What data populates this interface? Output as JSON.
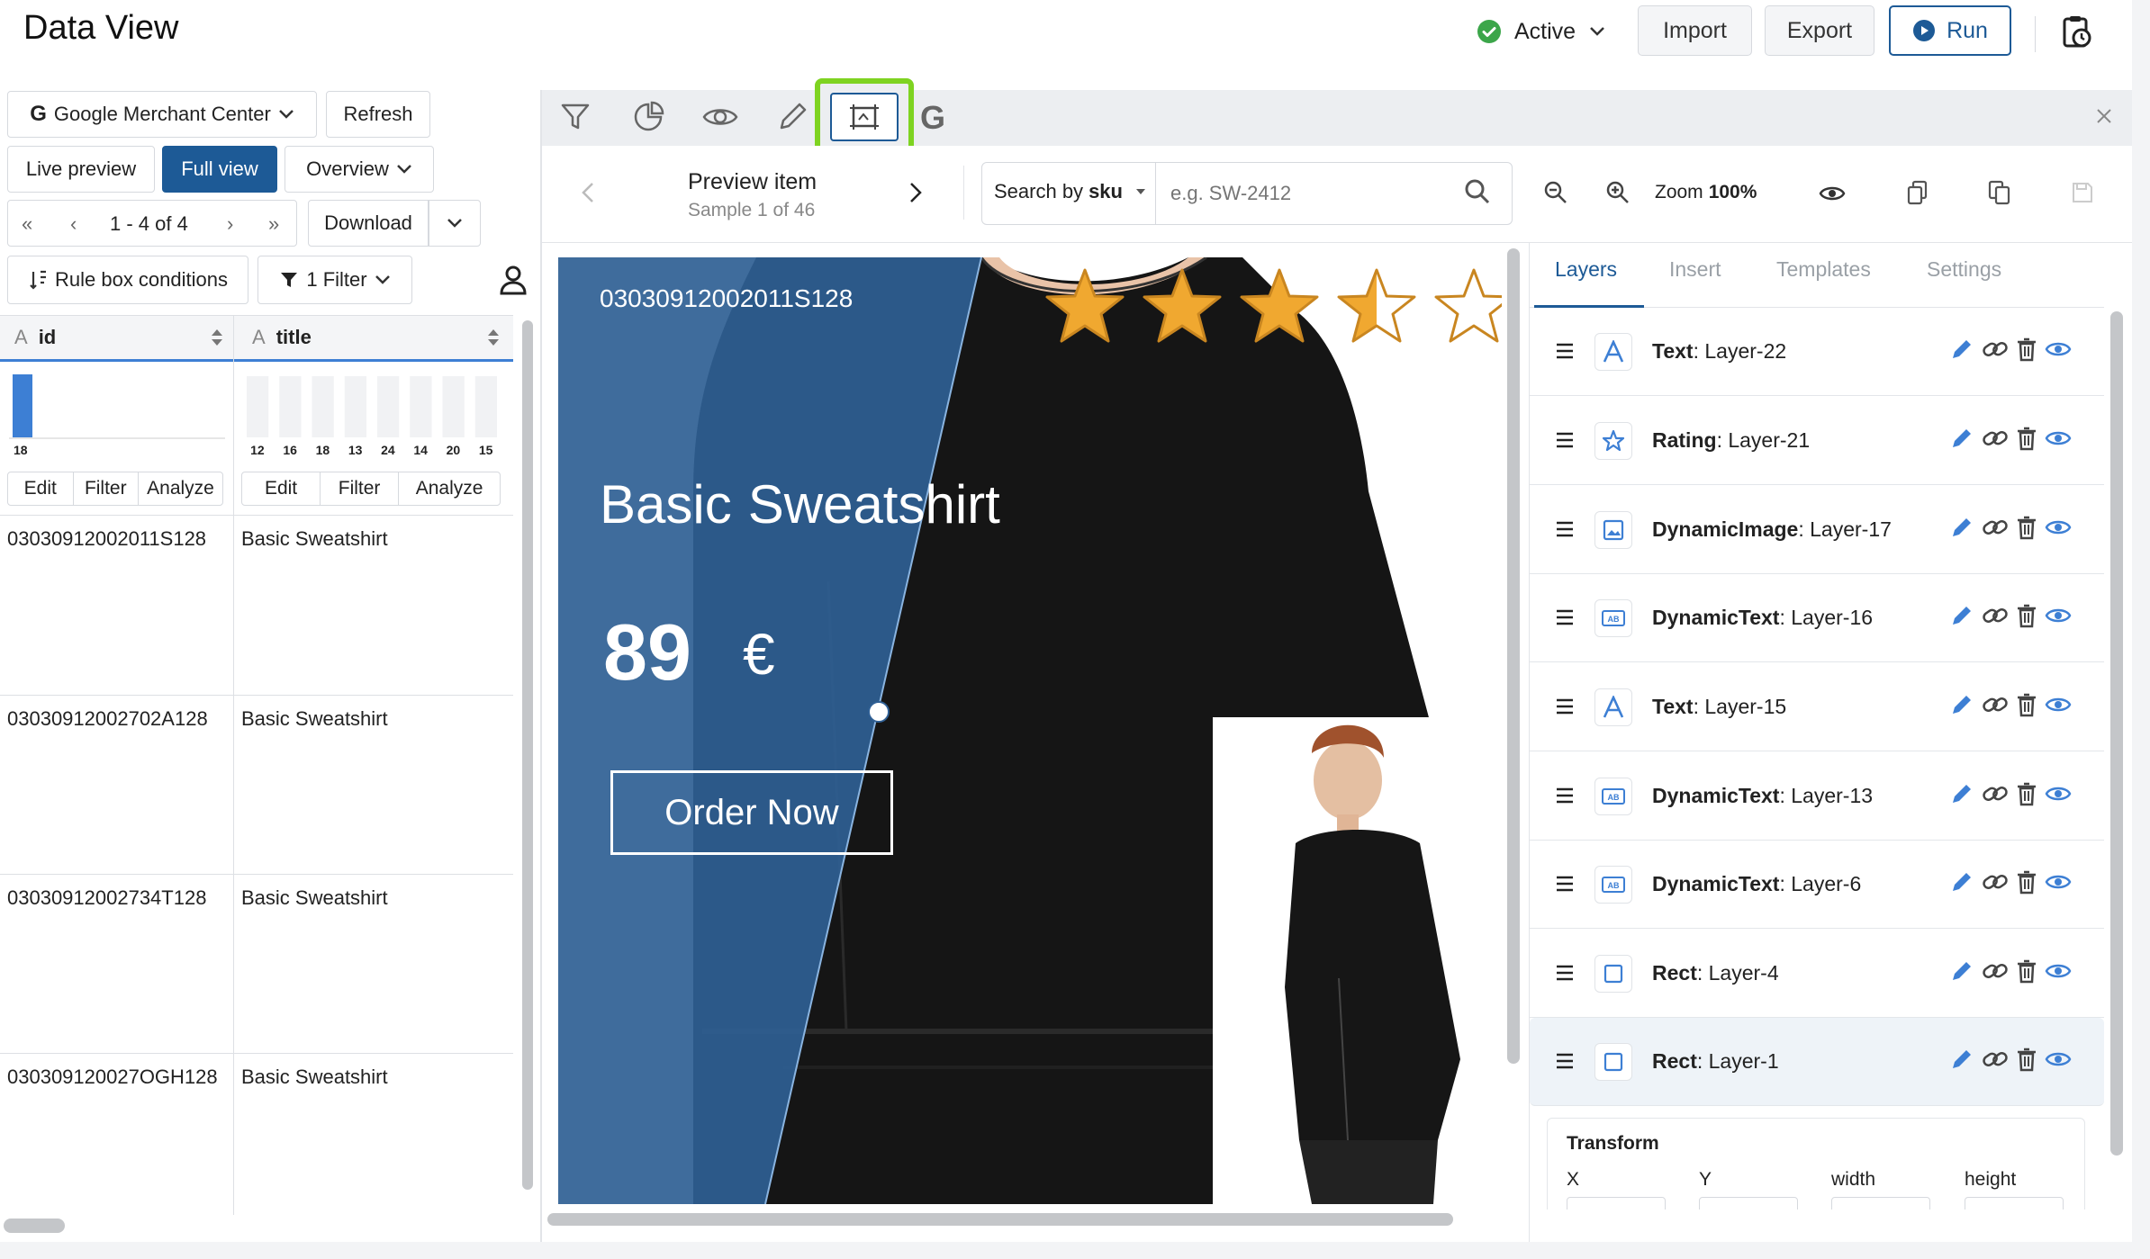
{
  "app": {
    "title": "Data View"
  },
  "header": {
    "status": "Active",
    "import_label": "Import",
    "export_label": "Export",
    "run_label": "Run"
  },
  "left": {
    "source_label": "Google Merchant Center",
    "refresh_label": "Refresh",
    "live_preview_label": "Live preview",
    "full_view_label": "Full view",
    "overview_label": "Overview",
    "pager": {
      "first": "«",
      "prev": "‹",
      "range": "1 - 4 of 4",
      "next": "›",
      "last": "»"
    },
    "download_label": "Download",
    "rule_box_label": "Rule box conditions",
    "filter_label": "1 Filter",
    "columns": [
      {
        "name": "id",
        "hist_labels": [
          "18"
        ],
        "edit": "Edit",
        "filter": "Filter",
        "analyze": "Analyze"
      },
      {
        "name": "title",
        "hist_labels": [
          "12",
          "16",
          "18",
          "13",
          "24",
          "14",
          "20",
          "15"
        ],
        "edit": "Edit",
        "filter": "Filter",
        "analyze": "Analyze"
      }
    ],
    "rows": [
      {
        "id": "03030912002011S128",
        "title": "Basic Sweatshirt"
      },
      {
        "id": "03030912002702A128",
        "title": "Basic Sweatshirt"
      },
      {
        "id": "03030912002734T128",
        "title": "Basic Sweatshirt"
      },
      {
        "id": "030309120027OGH128",
        "title": "Basic Sweatshirt"
      }
    ]
  },
  "preview": {
    "item_label": "Preview item",
    "sample_label": "Sample 1 of 46",
    "search_by": "Search by",
    "search_field": "sku",
    "search_placeholder": "e.g. SW-2412",
    "zoom_label": "Zoom",
    "zoom_value": "100%"
  },
  "canvas": {
    "sku": "03030912002011S128",
    "title_word1": "Basic",
    "title_word2": "Sweatshirt",
    "price": "89",
    "currency": "€",
    "cta": "Order Now",
    "rating": 3.5,
    "rating_max": 5
  },
  "panel": {
    "tabs": [
      "Layers",
      "Insert",
      "Templates",
      "Settings"
    ],
    "active_tab": "Layers",
    "layers": [
      {
        "type": "Text",
        "name": "Layer-22",
        "icon": "text-a-icon"
      },
      {
        "type": "Rating",
        "name": "Layer-21",
        "icon": "star-icon"
      },
      {
        "type": "DynamicImage",
        "name": "Layer-17",
        "icon": "image-icon"
      },
      {
        "type": "DynamicText",
        "name": "Layer-16",
        "icon": "dynamic-text-icon"
      },
      {
        "type": "Text",
        "name": "Layer-15",
        "icon": "text-a-icon"
      },
      {
        "type": "DynamicText",
        "name": "Layer-13",
        "icon": "dynamic-text-icon"
      },
      {
        "type": "DynamicText",
        "name": "Layer-6",
        "icon": "dynamic-text-icon"
      },
      {
        "type": "Rect",
        "name": "Layer-4",
        "icon": "rect-icon"
      },
      {
        "type": "Rect",
        "name": "Layer-1",
        "icon": "rect-icon"
      }
    ],
    "transform": {
      "title": "Transform",
      "x": "X",
      "y": "Y",
      "width": "width",
      "height": "height"
    }
  },
  "colors": {
    "accent": "#1d5a96",
    "active_green": "#3ca64a",
    "highlight": "#7ed321",
    "banner_blue": "#2f5f94",
    "star": "#f0a830"
  }
}
